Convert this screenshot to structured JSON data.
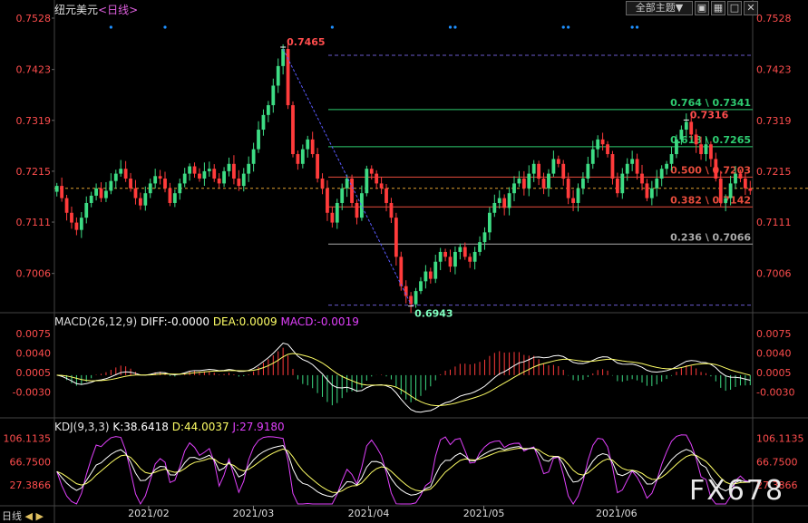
{
  "title": {
    "instrument": "纽元美元",
    "period": "<日线>"
  },
  "toolbar": {
    "theme_label": "全部主题",
    "theme_arrow": "▼"
  },
  "watermark": "FX678",
  "footer": {
    "label": "日线",
    "arrows": "◀ ▶"
  },
  "colors": {
    "bg": "#000000",
    "up": "#3ddc84",
    "down": "#ff3b3b",
    "axis": "#ff4d4d",
    "grid_dot": "#1e90ff",
    "fib_green": "#2ecc71",
    "fib_red": "#e74c3c",
    "fib_gray": "#aaaaaa",
    "diff": "#ffffff",
    "dea": "#ffff66",
    "kdj_k": "#ffffff",
    "kdj_d": "#ffff66",
    "kdj_j": "#e040fb",
    "zigzag": "#5a5aff"
  },
  "chart_data": [
    {
      "panel": "price",
      "type": "candlestick",
      "y_ticks": [
        "0.7528",
        "0.7423",
        "0.7319",
        "0.7215",
        "0.7111",
        "0.7006"
      ],
      "ylim": [
        0.6935,
        0.7528
      ],
      "x_labels": [
        "2021/02",
        "2021/03",
        "2021/04",
        "2021/05",
        "2021/06"
      ],
      "current_price": 0.718,
      "peak_labels": [
        {
          "text": "0.7465",
          "value": 0.7465
        },
        {
          "text": "0.6943",
          "value": 0.6943
        },
        {
          "text": "0.7316",
          "value": 0.7316
        }
      ],
      "fibonacci": [
        {
          "text": "0.764 \\ 0.7341",
          "value": 0.7341,
          "color": "green"
        },
        {
          "text": "0.618 \\ 0.7265",
          "value": 0.7265,
          "color": "green"
        },
        {
          "text": "0.500 \\ 0.7203",
          "value": 0.7203,
          "color": "red"
        },
        {
          "text": "0.382 \\ 0.7142",
          "value": 0.7142,
          "color": "red"
        },
        {
          "text": "0.236 \\ 0.7066",
          "value": 0.7066,
          "color": "gray"
        }
      ],
      "top_dashed_level": 0.7465,
      "bottom_dashed_level": 0.6943,
      "closes": [
        0.7185,
        0.716,
        0.713,
        0.711,
        0.7095,
        0.712,
        0.715,
        0.7165,
        0.718,
        0.716,
        0.7175,
        0.7195,
        0.721,
        0.722,
        0.72,
        0.718,
        0.716,
        0.7145,
        0.717,
        0.719,
        0.7205,
        0.72,
        0.718,
        0.715,
        0.717,
        0.719,
        0.721,
        0.7225,
        0.721,
        0.72,
        0.7215,
        0.722,
        0.72,
        0.719,
        0.7215,
        0.723,
        0.72,
        0.7185,
        0.721,
        0.723,
        0.726,
        0.73,
        0.733,
        0.735,
        0.739,
        0.743,
        0.7465,
        0.735,
        0.725,
        0.723,
        0.726,
        0.728,
        0.725,
        0.72,
        0.718,
        0.713,
        0.711,
        0.715,
        0.718,
        0.72,
        0.715,
        0.712,
        0.717,
        0.722,
        0.721,
        0.719,
        0.718,
        0.715,
        0.712,
        0.704,
        0.698,
        0.696,
        0.6943,
        0.697,
        0.699,
        0.701,
        0.6995,
        0.703,
        0.705,
        0.704,
        0.702,
        0.705,
        0.706,
        0.704,
        0.703,
        0.705,
        0.707,
        0.709,
        0.713,
        0.715,
        0.716,
        0.714,
        0.717,
        0.719,
        0.72,
        0.718,
        0.721,
        0.723,
        0.72,
        0.718,
        0.721,
        0.724,
        0.723,
        0.72,
        0.716,
        0.715,
        0.718,
        0.72,
        0.723,
        0.726,
        0.728,
        0.727,
        0.725,
        0.72,
        0.717,
        0.721,
        0.723,
        0.724,
        0.721,
        0.719,
        0.716,
        0.718,
        0.72,
        0.722,
        0.723,
        0.725,
        0.728,
        0.73,
        0.7316,
        0.729,
        0.727,
        0.725,
        0.727,
        0.724,
        0.72,
        0.715,
        0.716,
        0.719,
        0.721,
        0.72,
        0.718,
        0.7175
      ],
      "top_markers_x_index": [
        11,
        22,
        56,
        80,
        81,
        103,
        104,
        117,
        118
      ]
    },
    {
      "panel": "macd",
      "type": "line+bar",
      "legend": {
        "name": "MACD(26,12,9)",
        "diff": "DIFF:-0.0000",
        "dea": "DEA:0.0009",
        "macd": "MACD:-0.0019"
      },
      "y_ticks": [
        "0.0075",
        "0.0040",
        "0.0005",
        "-0.0030"
      ],
      "ylim": [
        -0.0072,
        0.0088
      ]
    },
    {
      "panel": "kdj",
      "type": "line",
      "legend": {
        "name": "KDJ(9,3,3)",
        "k": "K:38.6418",
        "d": "D:44.0037",
        "j": "J:27.9180"
      },
      "y_ticks": [
        "106.1135",
        "66.7500",
        "27.3866"
      ],
      "ylim": [
        -5,
        118
      ]
    }
  ]
}
